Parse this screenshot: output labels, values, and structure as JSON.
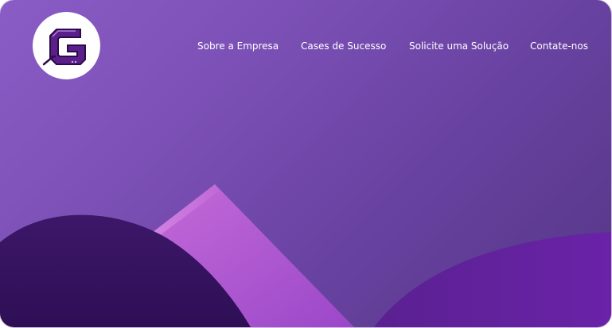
{
  "brand": {
    "logo_letter": "G",
    "logo_icon": "g-circuit-logo-icon"
  },
  "nav": {
    "items": [
      {
        "label": "Sobre a Empresa"
      },
      {
        "label": "Cases de Sucesso"
      },
      {
        "label": "Solicite uma Solução"
      },
      {
        "label": "Contate-nos"
      }
    ]
  },
  "colors": {
    "background": "#7a4fb4",
    "hill_dark": "#3a1666",
    "hill_right": "#5c2296",
    "slab_light": "#c36bd9",
    "logo_purple": "#5b1f8c",
    "text": "#ffffff"
  }
}
